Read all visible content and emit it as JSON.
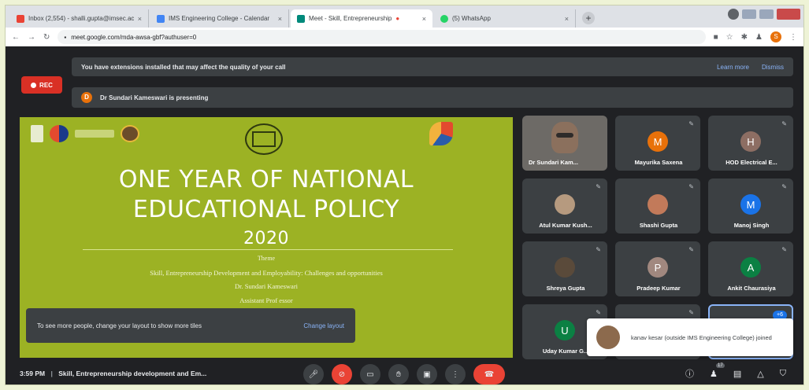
{
  "browser": {
    "tabs": [
      {
        "title": "Inbox (2,554) - shalli.gupta@imsec.ac.in",
        "favicon_color": "#ea4335"
      },
      {
        "title": "IMS Engineering College - Calendar",
        "favicon_color": "#4285f4"
      },
      {
        "title": "Meet - Skill, Entrepreneurship",
        "favicon_color": "#00897b"
      },
      {
        "title": "(5) WhatsApp",
        "favicon_color": "#25d366"
      }
    ],
    "new_tab": "+",
    "url": "meet.google.com/mda-awsa-gbf?authuser=0",
    "profile_initial": "S"
  },
  "banner": {
    "text": "You have extensions installed that may affect the quality of your call",
    "learn_more": "Learn more",
    "dismiss": "Dismiss"
  },
  "rec_label": "REC",
  "presenting": {
    "initial": "D",
    "text": "Dr Sundari Kameswari is presenting"
  },
  "slide": {
    "line1": "ONE YEAR OF NATIONAL",
    "line2": "EDUCATIONAL POLICY",
    "year": "2020",
    "theme_label": "Theme",
    "subtitle": "Skill, Entrepreneurship Development and Employability: Challenges and opportunities",
    "speaker": "Dr. Sundari Kameswari",
    "role": "Assistant Prof essor"
  },
  "layout_tip": {
    "message": "To see more people, change your layout to show more tiles",
    "action": "Change layout"
  },
  "participants": [
    {
      "name": "Dr Sundari Kam...",
      "type": "video"
    },
    {
      "name": "Mayurika Saxena",
      "initial": "M",
      "color": "#e8710a"
    },
    {
      "name": "HOD Electrical E...",
      "initial": "H",
      "color": "#8d6e63"
    },
    {
      "name": "Atul Kumar Kush...",
      "type": "photo"
    },
    {
      "name": "Shashi Gupta",
      "type": "photo"
    },
    {
      "name": "Manoj Singh",
      "initial": "M",
      "color": "#1a73e8"
    },
    {
      "name": "Shreya Gupta",
      "type": "photo"
    },
    {
      "name": "Pradeep Kumar",
      "initial": "P",
      "color": "#a1887f"
    },
    {
      "name": "Ankit Chaurasiya",
      "initial": "A",
      "color": "#0b8043"
    },
    {
      "name": "Uday Kumar G...",
      "initial": "U",
      "color": "#0b8043"
    }
  ],
  "more_count": "+6",
  "toast": {
    "text": "kanav kesar (outside IMS Engineering College) joined"
  },
  "bottom_bar": {
    "time": "3:59 PM",
    "separator": "|",
    "meeting": "Skill, Entrepreneurship development and Em...",
    "people_count": "17"
  }
}
